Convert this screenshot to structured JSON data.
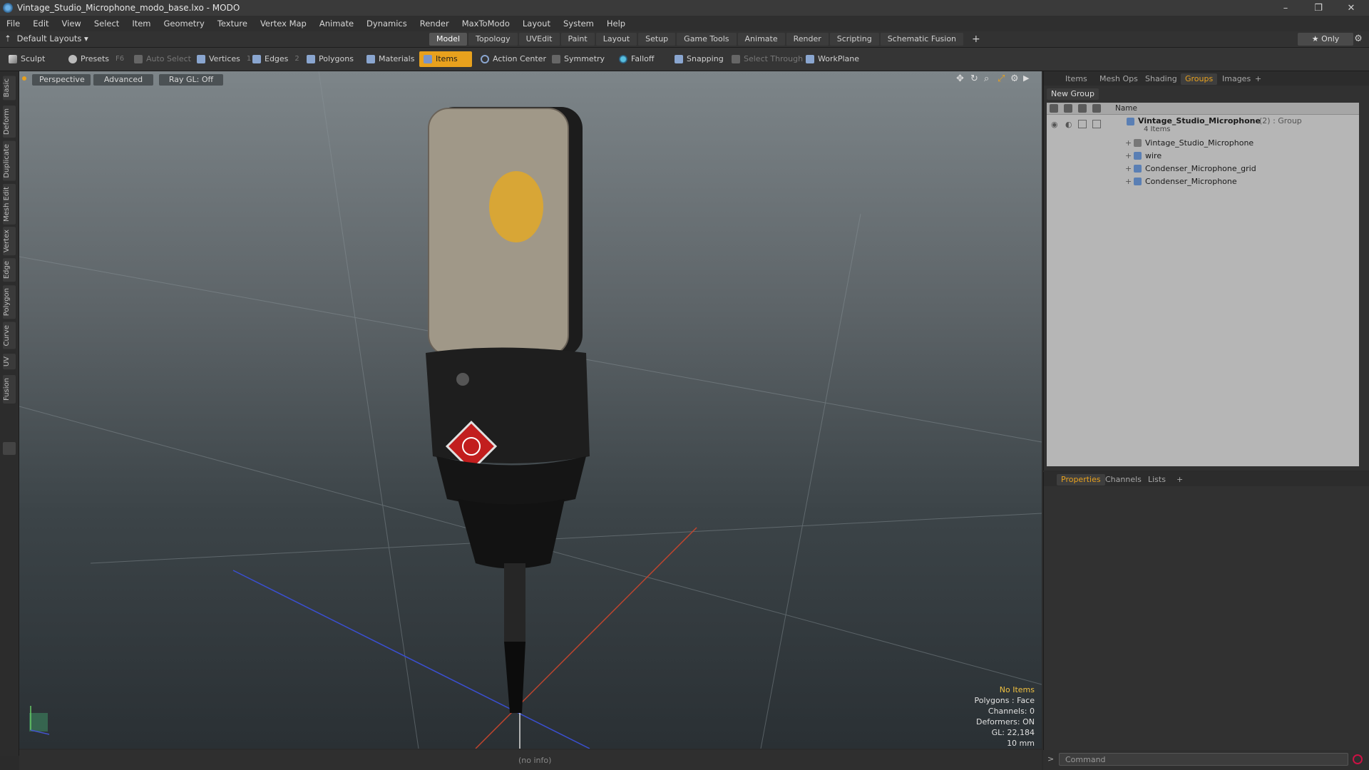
{
  "window": {
    "title": "Vintage_Studio_Microphone_modo_base.lxo - MODO",
    "minimize": "–",
    "restore": "❐",
    "close": "✕"
  },
  "menu": [
    "File",
    "Edit",
    "View",
    "Select",
    "Item",
    "Geometry",
    "Texture",
    "Vertex Map",
    "Animate",
    "Dynamics",
    "Render",
    "MaxToModo",
    "Layout",
    "System",
    "Help"
  ],
  "layout_bar": {
    "layouts_label": "Default Layouts ▾",
    "tabs": [
      "Model",
      "Topology",
      "UVEdit",
      "Paint",
      "Layout",
      "Setup",
      "Game Tools",
      "Animate",
      "Render",
      "Scripting",
      "Schematic Fusion"
    ],
    "active_tab": "Model",
    "add": "+",
    "only_label": "★ Only",
    "settings": "⚙"
  },
  "toolbar": {
    "sculpt": "Sculpt",
    "presets": "Presets",
    "presets_key": "F6",
    "auto_select": "Auto Select",
    "vertices": "Vertices",
    "vertices_count": "1",
    "edges": "Edges",
    "edges_count": "2",
    "polygons": "Polygons",
    "materials": "Materials",
    "items": "Items",
    "action_center": "Action Center",
    "symmetry": "Symmetry",
    "falloff": "Falloff",
    "snapping": "Snapping",
    "select_through": "Select Through",
    "workplane": "WorkPlane"
  },
  "left_tabs": [
    "Basic",
    "Deform",
    "Duplicate",
    "Mesh Edit",
    "Vertex",
    "Edge",
    "Polygon",
    "Curve",
    "UV",
    "Fusion"
  ],
  "viewport": {
    "view": "Perspective",
    "shading": "Advanced",
    "raygl": "Ray GL: Off",
    "info": {
      "items": "No Items",
      "polygons": "Polygons : Face",
      "channels": "Channels: 0",
      "deformers": "Deformers: ON",
      "gl": "GL: 22,184",
      "scale": "10 mm"
    },
    "status": "(no info)"
  },
  "right_panel": {
    "tabs": [
      "Items",
      "Mesh Ops",
      "Shading",
      "Groups",
      "Images"
    ],
    "active_tab": "Groups",
    "add": "+",
    "new_group": "New Group",
    "column_name": "Name",
    "group": {
      "name": "Vintage_Studio_Microphone",
      "suffix": "(2) : Group",
      "count": "4 Items",
      "children": [
        "Vintage_Studio_Microphone",
        "wire",
        "Condenser_Microphone_grid",
        "Condenser_Microphone"
      ]
    }
  },
  "properties_panel": {
    "tabs": [
      "Properties",
      "Channels",
      "Lists"
    ],
    "active_tab": "Properties",
    "add": "+"
  },
  "command": {
    "prompt": ">",
    "placeholder": "Command"
  },
  "colors": {
    "accent": "#e8a11d",
    "info_highlight": "#f0c040"
  }
}
